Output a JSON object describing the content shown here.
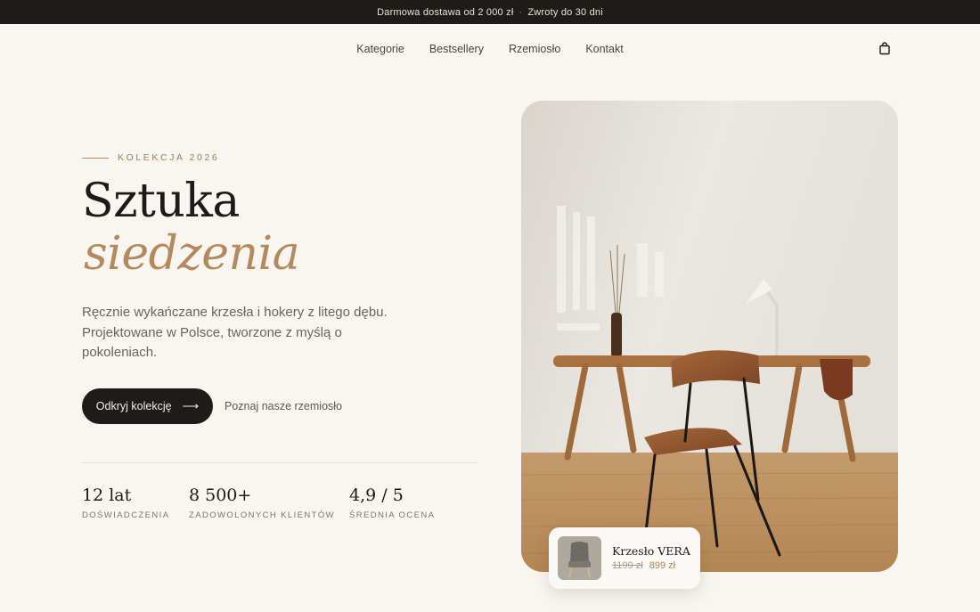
{
  "announcement": {
    "shipping": "Darmowa dostawa od 2 000 zł",
    "separator": "·",
    "returns": "Zwroty do 30 dni"
  },
  "nav": {
    "links": [
      "Kategorie",
      "Bestsellery",
      "Rzemiosło",
      "Kontakt"
    ],
    "cart_icon": "shopping-bag-icon"
  },
  "hero": {
    "eyebrow": "KOLEKCJA 2026",
    "title_line1": "Sztuka",
    "title_line2": "siedzenia",
    "lead": "Ręcznie wykańczane krzesła i hokery z litego dębu. Projektowane w Polsce, tworzone z myślą o pokoleniach.",
    "cta_primary": "Odkryj kolekcję",
    "cta_arrow": "⟶",
    "cta_secondary": "Poznaj nasze rzemiosło"
  },
  "stats": [
    {
      "value": "12 lat",
      "label": "DOŚWIADCZENIA"
    },
    {
      "value": "8 500+",
      "label": "ZADOWOLONYCH KLIENTÓW"
    },
    {
      "value": "4,9 / 5",
      "label": "ŚREDNIA OCENA"
    }
  ],
  "product_card": {
    "name": "Krzesło VERA",
    "old_price": "1199 zł",
    "price": "899 zł"
  },
  "colors": {
    "accent": "#b48a5c",
    "dark": "#1e1b18",
    "background": "#f9f6f2"
  }
}
